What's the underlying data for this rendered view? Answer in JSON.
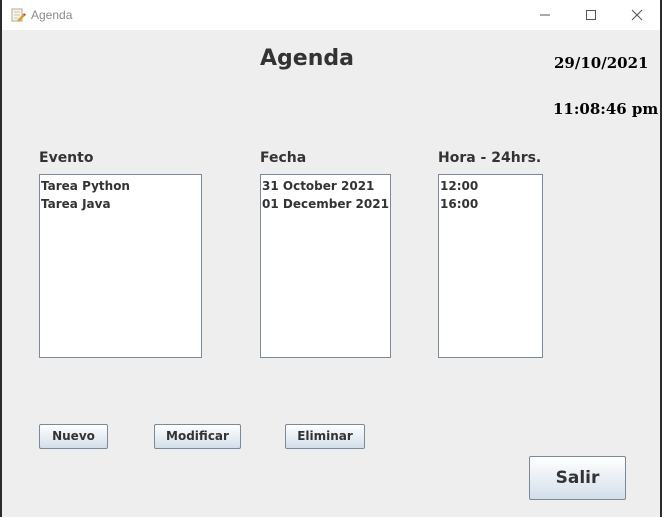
{
  "window": {
    "title": "Agenda"
  },
  "header": {
    "heading": "Agenda",
    "date": "29/10/2021",
    "time": "11:08:46 pm"
  },
  "columns": {
    "evento": {
      "label": "Evento",
      "items": [
        "Tarea Python",
        "Tarea Java"
      ]
    },
    "fecha": {
      "label": "Fecha",
      "items": [
        "31 October 2021",
        "01 December 2021"
      ]
    },
    "hora": {
      "label": "Hora - 24hrs.",
      "items": [
        "12:00",
        "16:00"
      ]
    }
  },
  "buttons": {
    "nuevo": "Nuevo",
    "modificar": "Modificar",
    "eliminar": "Eliminar",
    "salir": "Salir"
  },
  "icons": {
    "app": "notepad-pencil-icon",
    "minimize": "minimize-icon",
    "maximize": "maximize-icon",
    "close": "close-icon"
  }
}
